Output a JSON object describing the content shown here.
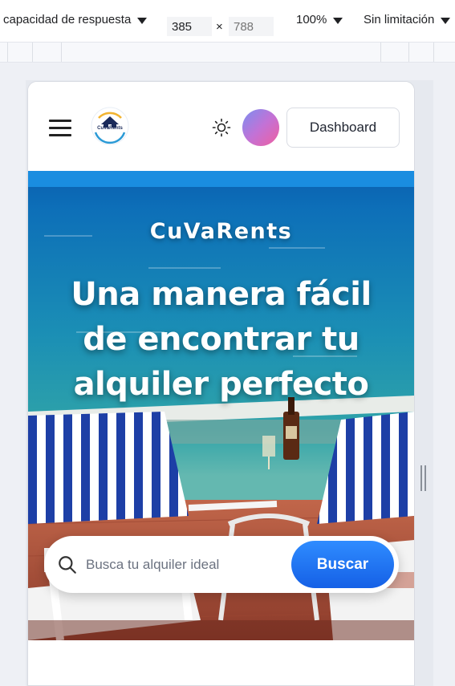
{
  "devtools": {
    "device_mode": "capacidad de respuesta",
    "width": "385",
    "height_placeholder": "788",
    "times": "×",
    "zoom": "100%",
    "throttling": "Sin limitación"
  },
  "header": {
    "logo_text": "CuVaRents",
    "dashboard_label": "Dashboard"
  },
  "hero": {
    "brand": "CuVaRents",
    "headline_lines": [
      "Una manera fácil",
      "de encontrar tu",
      "alquiler perfecto"
    ],
    "search_placeholder": "Busca tu alquiler ideal",
    "search_button": "Buscar"
  },
  "colors": {
    "accent": "#1f6ff2",
    "sea": "#1f8fb0",
    "deck": "#b5523c"
  },
  "icons": {
    "menu": "hamburger-icon",
    "theme": "sun-icon",
    "search": "search-icon"
  }
}
